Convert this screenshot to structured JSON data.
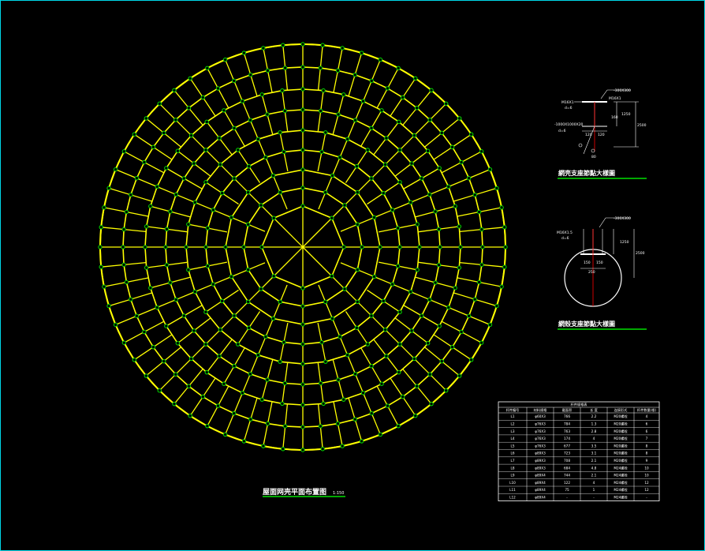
{
  "drawing": {
    "main_title": "屋面网壳平面布置图",
    "main_scale": "1:150",
    "detail1_title": "網壳支座節點大樣圖",
    "detail2_title": "網殼支座節點大樣圖",
    "detail1_labels": [
      "-300X300",
      "M16X1",
      "M16X1",
      "d=6",
      "-1000X1000X20",
      "d=6",
      "160",
      "120",
      "120",
      "1250",
      "2500",
      "80"
    ],
    "detail2_labels": [
      "-300X300",
      "d=6",
      "M16X1.5",
      "150",
      "150",
      "1250",
      "2500",
      "250"
    ],
    "colors": {
      "background": "#000000",
      "frame": "#00d7e8",
      "members": "#ffff00",
      "nodes": "#00e000",
      "detail_lines": "#ffffff",
      "title": "#ffffff",
      "underline": "#00e000",
      "anchor": "#ff0000"
    }
  },
  "table": {
    "caption": "杆件规格表",
    "headers": [
      "杆件编号",
      "材料规格",
      "截面积",
      "长 度",
      "连接形式",
      "杆件数量(根)"
    ],
    "rows": [
      [
        "L1",
        "φ60X3",
        "766",
        "2.2",
        "M20螺栓",
        "4"
      ],
      [
        "L2",
        "φ76X3",
        "784",
        "1.3",
        "M20螺栓",
        "6"
      ],
      [
        "L3",
        "φ76X3",
        "763",
        "2.8",
        "M20螺栓",
        "6"
      ],
      [
        "L4",
        "φ76X3",
        "174",
        "4",
        "M20螺栓",
        "7"
      ],
      [
        "L5",
        "φ76X3",
        "677",
        "3.5",
        "M20螺栓",
        "8"
      ],
      [
        "L6",
        "φ89X3",
        "723",
        "3.1",
        "M20螺栓",
        "8"
      ],
      [
        "L7",
        "φ89X3",
        "708",
        "2.1",
        "M20螺栓",
        "9"
      ],
      [
        "L8",
        "φ89X3",
        "684",
        "4.8",
        "M24螺栓",
        "10"
      ],
      [
        "L9",
        "φ89X4",
        "744",
        "2.1",
        "M24螺栓",
        "10"
      ],
      [
        "L10",
        "φ89X4",
        "122",
        "4",
        "M24螺栓",
        "12"
      ],
      [
        "L11",
        "φ89X4",
        "75",
        "1",
        "M24螺栓",
        "12"
      ],
      [
        "L12",
        "φ89X4",
        "-",
        "-",
        "M24螺栓",
        "-"
      ]
    ]
  }
}
